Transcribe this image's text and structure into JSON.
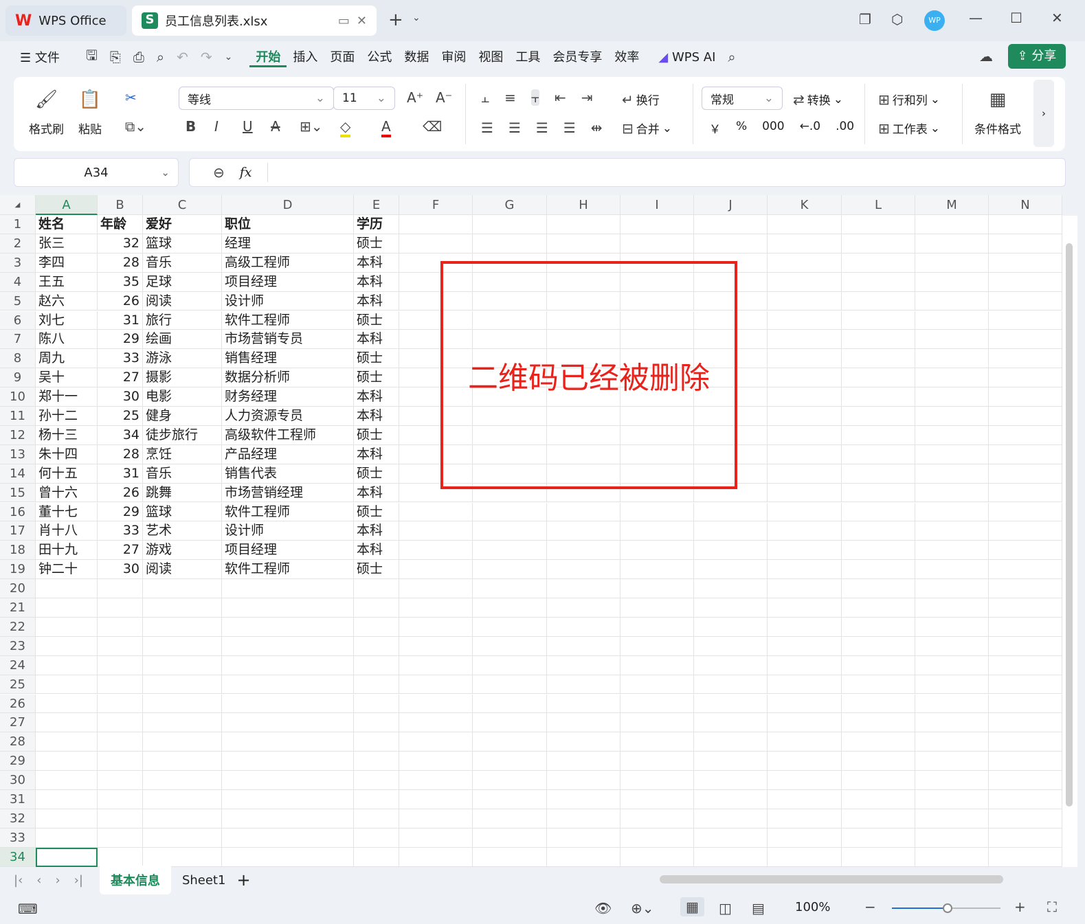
{
  "tabs": {
    "home": "WPS Office",
    "file": "员工信息列表.xlsx",
    "file_icon": "S"
  },
  "menu": {
    "file": "文件",
    "items": [
      "开始",
      "插入",
      "页面",
      "公式",
      "数据",
      "审阅",
      "视图",
      "工具",
      "会员专享",
      "效率"
    ],
    "ai": "WPS AI",
    "share": "分享",
    "avatar": "WP"
  },
  "ribbon": {
    "format_painter": "格式刷",
    "paste": "粘贴",
    "font": "等线",
    "size": "11",
    "wrap": "换行",
    "merge": "合并",
    "number_format": "常规",
    "convert": "转换",
    "rows_cols": "行和列",
    "worksheet": "工作表",
    "cond_format": "条件格式",
    "bold": "B",
    "italic": "I",
    "underline": "U",
    "percent": "%",
    "thousands": "000",
    "currency": "￥"
  },
  "formula": {
    "cell_ref": "A34",
    "fx": "fx",
    "value": ""
  },
  "columns": [
    "A",
    "B",
    "C",
    "D",
    "E",
    "F",
    "G",
    "H",
    "I",
    "J",
    "K",
    "L",
    "M",
    "N"
  ],
  "rows": [
    [
      "姓名",
      "年龄",
      "爱好",
      "职位",
      "学历"
    ],
    [
      "张三",
      "32",
      "篮球",
      "经理",
      "硕士"
    ],
    [
      "李四",
      "28",
      "音乐",
      "高级工程师",
      "本科"
    ],
    [
      "王五",
      "35",
      "足球",
      "项目经理",
      "本科"
    ],
    [
      "赵六",
      "26",
      "阅读",
      "设计师",
      "本科"
    ],
    [
      "刘七",
      "31",
      "旅行",
      "软件工程师",
      "硕士"
    ],
    [
      "陈八",
      "29",
      "绘画",
      "市场营销专员",
      "本科"
    ],
    [
      "周九",
      "33",
      "游泳",
      "销售经理",
      "硕士"
    ],
    [
      "吴十",
      "27",
      "摄影",
      "数据分析师",
      "硕士"
    ],
    [
      "郑十一",
      "30",
      "电影",
      "财务经理",
      "本科"
    ],
    [
      "孙十二",
      "25",
      "健身",
      "人力资源专员",
      "本科"
    ],
    [
      "杨十三",
      "34",
      "徒步旅行",
      "高级软件工程师",
      "硕士"
    ],
    [
      "朱十四",
      "28",
      "烹饪",
      "产品经理",
      "本科"
    ],
    [
      "何十五",
      "31",
      "音乐",
      "销售代表",
      "硕士"
    ],
    [
      "曾十六",
      "26",
      "跳舞",
      "市场营销经理",
      "本科"
    ],
    [
      "董十七",
      "29",
      "篮球",
      "软件工程师",
      "硕士"
    ],
    [
      "肖十八",
      "33",
      "艺术",
      "设计师",
      "本科"
    ],
    [
      "田十九",
      "27",
      "游戏",
      "项目经理",
      "本科"
    ],
    [
      "钟二十",
      "30",
      "阅读",
      "软件工程师",
      "硕士"
    ]
  ],
  "row_count": 34,
  "overlay_text": "二维码已经被删除",
  "sheets": [
    "基本信息",
    "Sheet1"
  ],
  "status": {
    "zoom": "100%"
  },
  "colors": {
    "accent": "#1f8a5b",
    "red": "#e8231c"
  }
}
